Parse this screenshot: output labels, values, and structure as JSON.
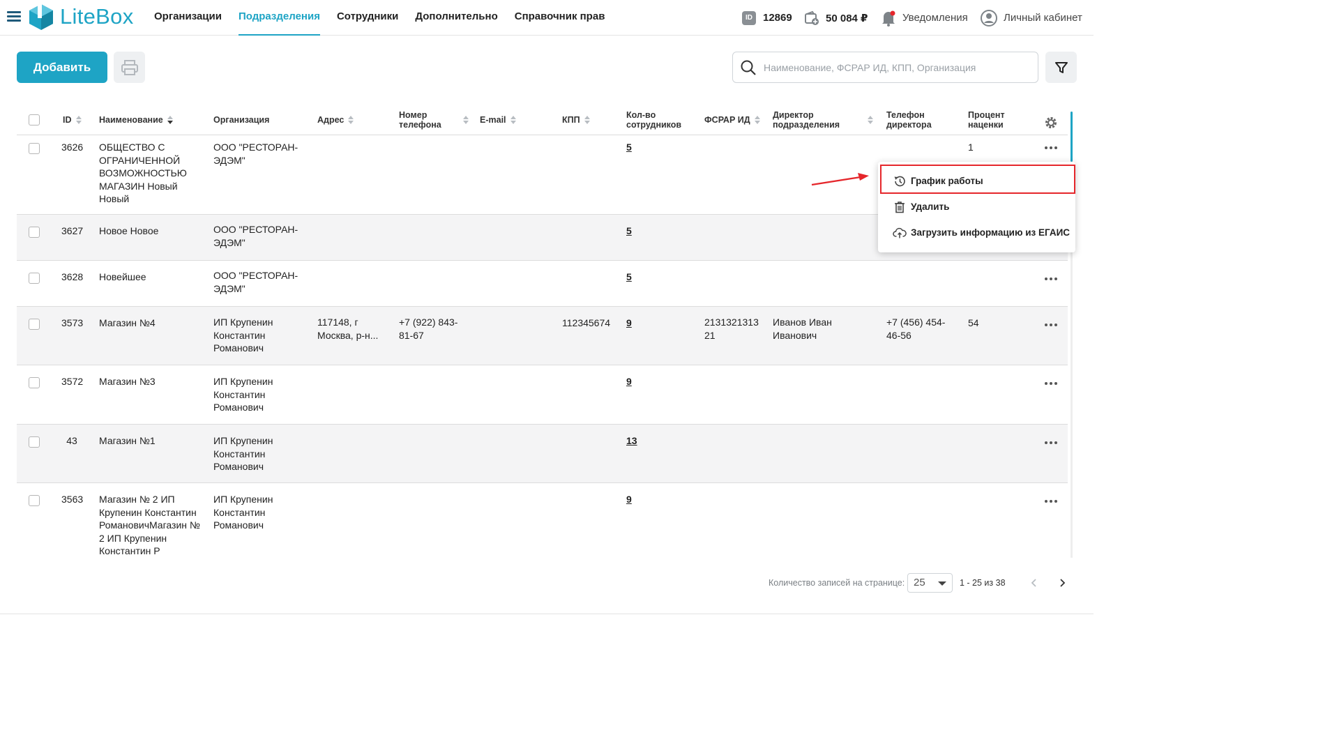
{
  "app": {
    "brand": "LiteBox",
    "accent_color": "#1ea4c5"
  },
  "nav": {
    "items": [
      {
        "label": "Организации",
        "active": false
      },
      {
        "label": "Подразделения",
        "active": true
      },
      {
        "label": "Сотрудники",
        "active": false
      },
      {
        "label": "Дополнительно",
        "active": false
      },
      {
        "label": "Справочник прав",
        "active": false
      }
    ]
  },
  "header": {
    "id_badge": "ID",
    "account_id": "12869",
    "balance": "50 084 ₽",
    "notifications_label": "Уведомления",
    "cabinet_label": "Личный кабинет"
  },
  "toolbar": {
    "add_label": "Добавить",
    "search_placeholder": "Наименование, ФСРАР ИД, КПП, Организация"
  },
  "table": {
    "columns": {
      "id": "ID",
      "name": "Наименование",
      "org": "Организация",
      "address": "Адрес",
      "phone": "Номер телефона",
      "email": "E-mail",
      "kpp": "КПП",
      "employees": "Кол-во сотрудников",
      "fsrar": "ФСРАР ИД",
      "director": "Директор подразделения",
      "director_phone": "Телефон директора",
      "markup": "Процент наценки"
    },
    "rows": [
      {
        "id": "3626",
        "name": "ОБЩЕСТВО С ОГРАНИЧЕННОЙ ВОЗМОЖНОСТЬЮ МАГАЗИН Новый Новый",
        "org": "ООО \"РЕСТОРАН-ЭДЭМ\"",
        "address": "",
        "phone": "",
        "email": "",
        "kpp": "",
        "employees": "5",
        "fsrar": "",
        "director": "",
        "director_phone": "",
        "markup": "1"
      },
      {
        "id": "3627",
        "name": "Новое Новое",
        "org": "ООО \"РЕСТОРАН-ЭДЭМ\"",
        "address": "",
        "phone": "",
        "email": "",
        "kpp": "",
        "employees": "5",
        "fsrar": "",
        "director": "",
        "director_phone": "",
        "markup": ""
      },
      {
        "id": "3628",
        "name": "Новейшее",
        "org": "ООО \"РЕСТОРАН-ЭДЭМ\"",
        "address": "",
        "phone": "",
        "email": "",
        "kpp": "",
        "employees": "5",
        "fsrar": "",
        "director": "",
        "director_phone": "",
        "markup": ""
      },
      {
        "id": "3573",
        "name": "Магазин №4",
        "org": "ИП Крупенин Константин Романович",
        "address": "117148, г Москва, р-н...",
        "phone": "+7 (922) 843-81-67",
        "email": "",
        "kpp": "112345674",
        "employees": "9",
        "fsrar": "213132131321",
        "director": "Иванов Иван Иванович",
        "director_phone": "+7 (456) 454-46-56",
        "markup": "54"
      },
      {
        "id": "3572",
        "name": "Магазин №3",
        "org": "ИП Крупенин Константин Романович",
        "address": "",
        "phone": "",
        "email": "",
        "kpp": "",
        "employees": "9",
        "fsrar": "",
        "director": "",
        "director_phone": "",
        "markup": ""
      },
      {
        "id": "43",
        "name": "Магазин №1",
        "org": "ИП Крупенин Константин Романович",
        "address": "",
        "phone": "",
        "email": "",
        "kpp": "",
        "employees": "13",
        "fsrar": "",
        "director": "",
        "director_phone": "",
        "markup": ""
      },
      {
        "id": "3563",
        "name": "Магазин № 2 ИП Крупенин Константин РомановичМагазин № 2 ИП Крупенин Константин Р",
        "org": "ИП Крупенин Константин Романович",
        "address": "",
        "phone": "",
        "email": "",
        "kpp": "",
        "employees": "9",
        "fsrar": "",
        "director": "",
        "director_phone": "",
        "markup": ""
      }
    ]
  },
  "context_menu": {
    "items": [
      {
        "label": "График работы",
        "icon": "history-icon"
      },
      {
        "label": "Удалить",
        "icon": "trash-icon"
      },
      {
        "label": "Загрузить информацию из ЕГАИС",
        "icon": "cloud-upload-icon"
      }
    ]
  },
  "annotation": {
    "highlight_color": "#e5262b"
  },
  "pagination": {
    "per_page_label": "Количество записей на странице:",
    "per_page_value": "25",
    "range_label": "1 - 25 из 38"
  }
}
